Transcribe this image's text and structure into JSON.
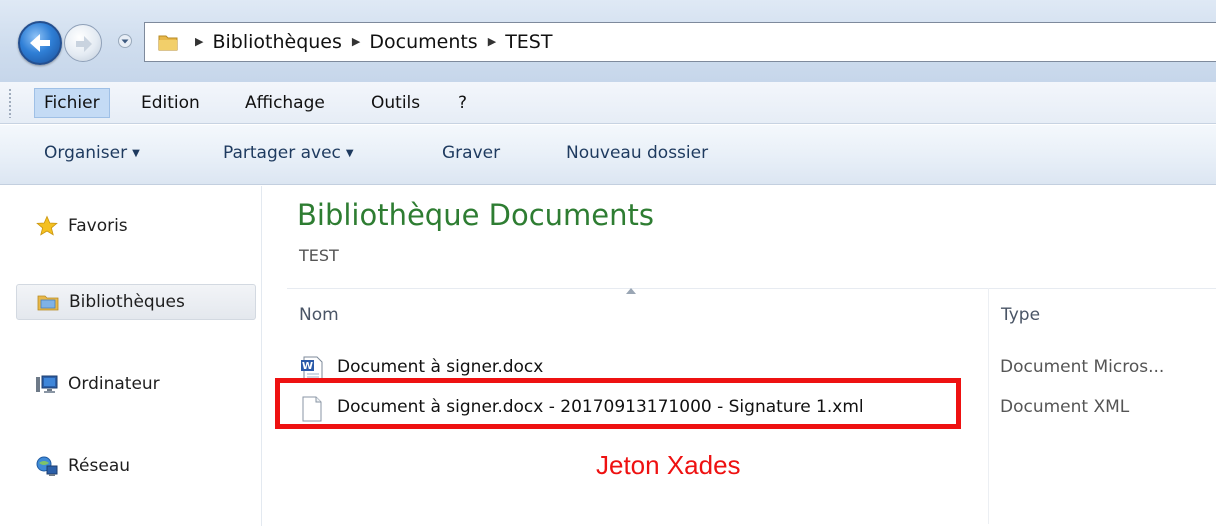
{
  "address": {
    "icons": [
      "back-icon",
      "forward-icon",
      "history-dropdown-icon",
      "folder-icon"
    ],
    "crumbs": [
      "Bibliothèques",
      "Documents",
      "TEST"
    ]
  },
  "menu": {
    "items": [
      "Fichier",
      "Edition",
      "Affichage",
      "Outils",
      "?"
    ],
    "active": "Fichier"
  },
  "commands": {
    "organize": "Organiser",
    "share": "Partager avec",
    "burn": "Graver",
    "new_folder": "Nouveau dossier"
  },
  "nav": {
    "items": [
      {
        "label": "Favoris",
        "icon": "star-icon"
      },
      {
        "label": "Bibliothèques",
        "icon": "libraries-icon"
      },
      {
        "label": "Ordinateur",
        "icon": "computer-icon"
      },
      {
        "label": "Réseau",
        "icon": "network-icon"
      }
    ],
    "selected": "Bibliothèques"
  },
  "content": {
    "title": "Bibliothèque Documents",
    "subtitle": "TEST",
    "columns": [
      "Nom",
      "Type"
    ],
    "files": [
      {
        "name": "Document à signer.docx",
        "type": "Document Micros...",
        "icon": "word-doc-icon"
      },
      {
        "name": "Document à signer.docx - 20170913171000 - Signature 1.xml",
        "type": "Document XML",
        "icon": "xml-file-icon"
      }
    ]
  },
  "annotation": {
    "label": "Jeton Xades",
    "color": "#ee1111"
  },
  "colors": {
    "title_green": "#2e7d32",
    "command_text": "#1e3a5f",
    "menu_active": "#c4dbf5"
  }
}
